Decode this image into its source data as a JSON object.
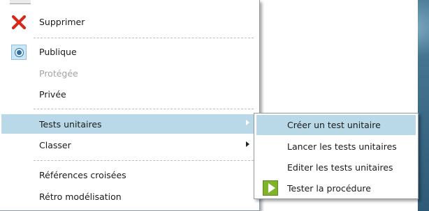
{
  "context_menu": {
    "items": {
      "delete": {
        "label": "Supprimer",
        "icon": "red-x-icon"
      },
      "public": {
        "label": "Publique",
        "icon": "radio-selected-icon",
        "checked": true
      },
      "protected": {
        "label": "Protégée",
        "disabled": true
      },
      "private": {
        "label": "Privée"
      },
      "unit_tests": {
        "label": "Tests unitaires",
        "has_submenu": true,
        "highlighted": true
      },
      "sort": {
        "label": "Classer",
        "has_submenu": true
      },
      "cross_references": {
        "label": "Références croisées"
      },
      "reverse_engineering": {
        "label": "Rétro modélisation"
      }
    }
  },
  "submenu": {
    "items": {
      "create_test": {
        "label": "Créer un test unitaire",
        "highlighted": true
      },
      "run_tests": {
        "label": "Lancer les tests unitaires"
      },
      "edit_tests": {
        "label": "Editer les tests unitaires"
      },
      "test_procedure": {
        "label": "Tester la procédure",
        "icon": "play-icon"
      }
    }
  },
  "colors": {
    "highlight": "#b9d9e8",
    "disabled_text": "#a3a3a3",
    "delete_icon": "#d42a1e",
    "play_icon": "#7fb32b"
  }
}
